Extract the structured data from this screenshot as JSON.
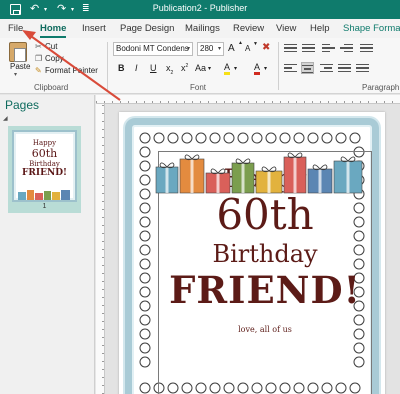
{
  "window": {
    "title": "Publication2 - Publisher",
    "quick_access_icons": [
      "save-icon",
      "undo-icon",
      "redo-icon"
    ]
  },
  "tabs": [
    {
      "label": "File"
    },
    {
      "label": "Home",
      "active": true
    },
    {
      "label": "Insert"
    },
    {
      "label": "Page Design"
    },
    {
      "label": "Mailings"
    },
    {
      "label": "Review"
    },
    {
      "label": "View"
    },
    {
      "label": "Help"
    },
    {
      "label": "Shape Format"
    }
  ],
  "ribbon": {
    "clipboard": {
      "paste_label": "Paste",
      "cut_label": "Cut",
      "copy_label": "Copy",
      "format_painter_label": "Format Painter",
      "group_label": "Clipboard"
    },
    "font": {
      "font_name": "Bodoni MT Condens",
      "font_size": "280",
      "grow_label": "A",
      "shrink_label": "A",
      "bold_label": "B",
      "italic_label": "I",
      "underline_label": "U",
      "subscript_label": "x",
      "superscript_label": "x",
      "case_label": "Aa",
      "highlight_label": "A",
      "color_label": "A",
      "group_label": "Font"
    },
    "paragraph": {
      "group_label": "Paragraph"
    }
  },
  "pages_pane": {
    "title": "Pages",
    "page_number": "1"
  },
  "card": {
    "line1": "Happy",
    "line2": "60th",
    "line3": "Birthday",
    "line4": "FRIEND!",
    "signature": "love, all of us"
  },
  "colors": {
    "title_bar": "#0f7b6c",
    "card_text": "#5c1b17",
    "frame": "#a9cbd6",
    "arrow": "#d94b3a"
  }
}
